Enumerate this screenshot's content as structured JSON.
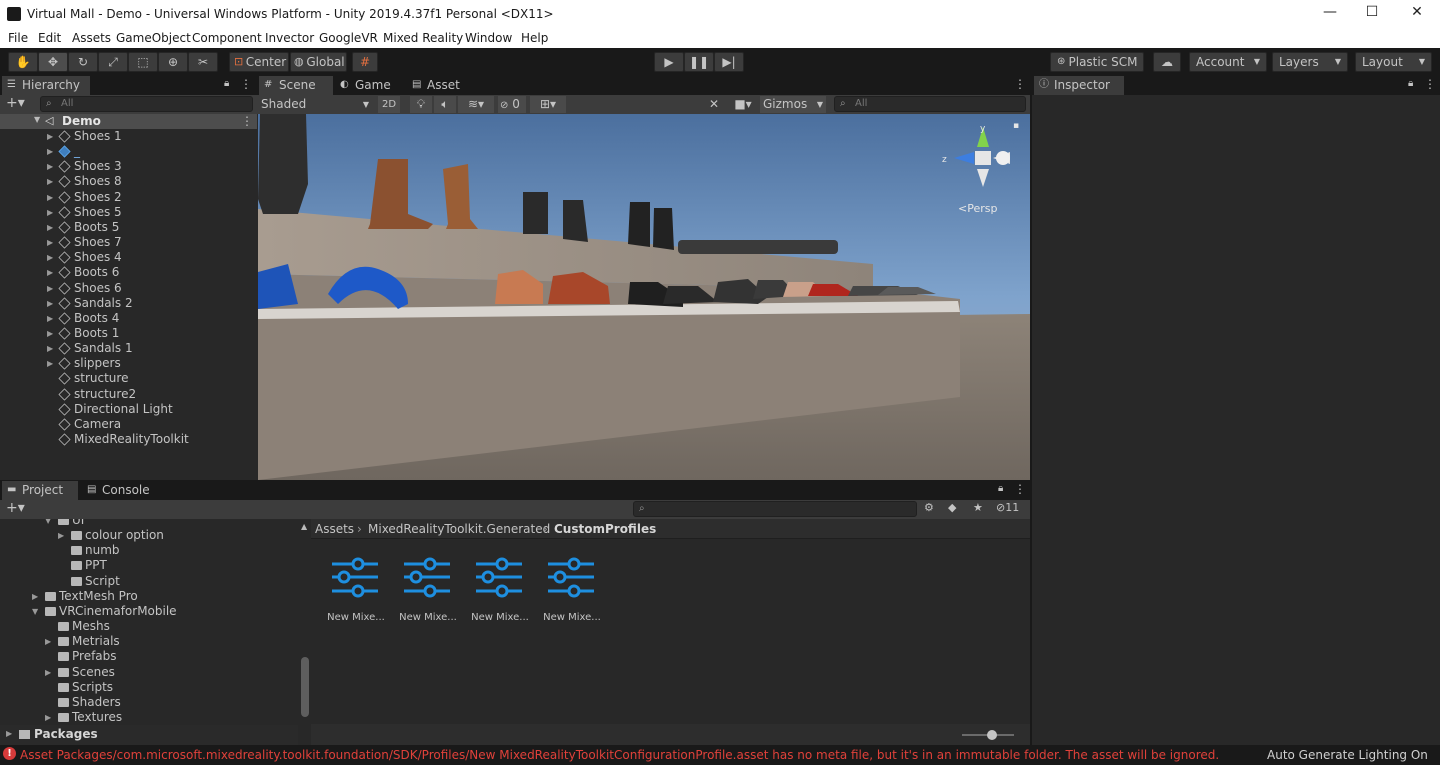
{
  "window": {
    "title": "Virtual Mall - Demo - Universal Windows Platform - Unity 2019.4.37f1 Personal <DX11>",
    "minimize": "—",
    "maximize": "☐",
    "close": "✕"
  },
  "menu": [
    "File",
    "Edit",
    "Assets",
    "GameObject",
    "Component",
    "Invector",
    "GoogleVR",
    "Mixed Reality",
    "Window",
    "Help"
  ],
  "toolbar": {
    "pivot": "Center",
    "space": "Global",
    "plastic": "Plastic SCM",
    "account": "Account",
    "layers": "Layers",
    "layout": "Layout"
  },
  "hierarchy": {
    "tab": "Hierarchy",
    "search_placeholder": "All",
    "scene": "Demo",
    "items": [
      "Shoes 1",
      "_",
      "Shoes 3",
      "Shoes 8",
      "Shoes 2",
      "Shoes 5",
      "Boots 5",
      "Shoes 7",
      "Shoes 4",
      "Boots 6",
      "Shoes 6",
      "Sandals 2",
      "Boots 4",
      "Boots 1",
      "Sandals 1",
      "slippers",
      "structure",
      "structure2",
      "Directional Light",
      "Camera",
      "MixedRealityToolkit"
    ]
  },
  "scene": {
    "tabs": [
      "Scene",
      "Game",
      "Asset Store"
    ],
    "shading": "Shaded",
    "mode2d": "2D",
    "hidden_count": "0",
    "gizmos": "Gizmos",
    "search_placeholder": "All",
    "persp": "Persp",
    "axis_y": "y",
    "axis_z": "z"
  },
  "inspector": {
    "tab": "Inspector"
  },
  "project": {
    "tabs": [
      "Project",
      "Console"
    ],
    "hidden_count": "11",
    "tree": [
      {
        "label": "UI",
        "depth": 2,
        "expanded": true
      },
      {
        "label": "colour option",
        "depth": 3,
        "arrow": true
      },
      {
        "label": "numb",
        "depth": 3
      },
      {
        "label": "PPT",
        "depth": 3
      },
      {
        "label": "Script",
        "depth": 3
      },
      {
        "label": "TextMesh Pro",
        "depth": 1,
        "arrow": true
      },
      {
        "label": "VRCinemaforMobile",
        "depth": 1,
        "expanded": true
      },
      {
        "label": "Meshs",
        "depth": 2
      },
      {
        "label": "Metrials",
        "depth": 2,
        "arrow": true
      },
      {
        "label": "Prefabs",
        "depth": 2
      },
      {
        "label": "Scenes",
        "depth": 2,
        "arrow": true
      },
      {
        "label": "Scripts",
        "depth": 2
      },
      {
        "label": "Shaders",
        "depth": 2
      },
      {
        "label": "Textures",
        "depth": 2,
        "arrow": true
      }
    ],
    "packages": "Packages",
    "breadcrumb": [
      "Assets",
      "MixedRealityToolkit.Generated",
      "CustomProfiles"
    ],
    "assets": [
      "New Mixe...",
      "New Mixe...",
      "New Mixe...",
      "New Mixe..."
    ]
  },
  "status": {
    "error": "Asset Packages/com.microsoft.mixedreality.toolkit.foundation/SDK/Profiles/New MixedRealityToolkitConfigurationProfile.asset has no meta file, but it's in an immutable folder. The asset will be ignored.",
    "right": "Auto Generate Lighting On"
  }
}
